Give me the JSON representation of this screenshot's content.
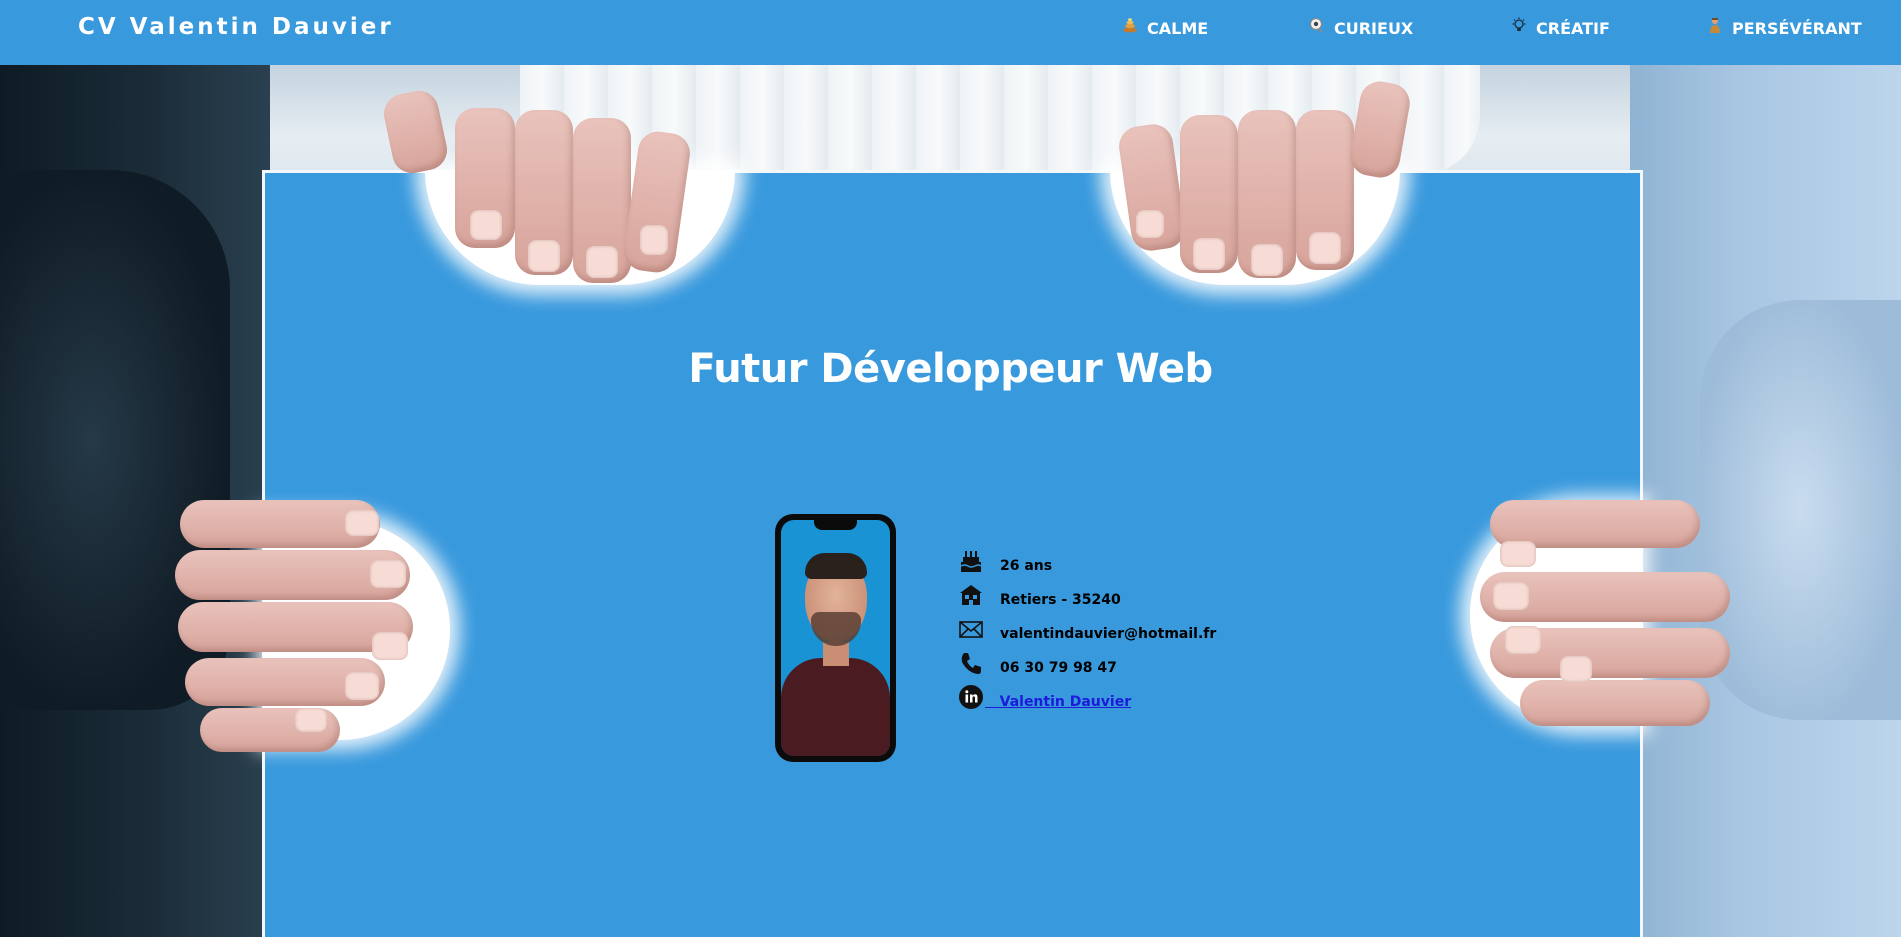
{
  "header": {
    "brand": "CV Valentin Dauvier",
    "nav": [
      {
        "label": "CALME",
        "icon": "pebble-stack-icon"
      },
      {
        "label": "CURIEUX",
        "icon": "magnifier-eye-icon"
      },
      {
        "label": "CRÉATIF",
        "icon": "lightbulb-icon"
      },
      {
        "label": "PERSÉVÉRANT",
        "icon": "climber-icon"
      }
    ]
  },
  "main": {
    "title": "Futur Développeur Web",
    "profile": {
      "photo": "portrait-photo"
    },
    "info": {
      "age": "26 ans",
      "location": "Retiers - 35240",
      "email": "valentindauvier@hotmail.fr",
      "phone": "06 30 79 98 47",
      "linkedin": "Valentin Dauvier"
    }
  },
  "colors": {
    "primary": "#3899dd",
    "text_dark": "#000000",
    "link": "#1b1bd9"
  }
}
